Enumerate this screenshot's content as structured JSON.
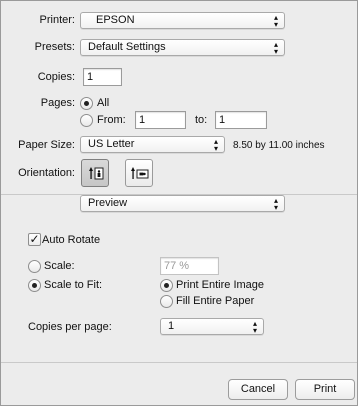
{
  "printer": {
    "label": "Printer:",
    "value": "EPSON"
  },
  "presets": {
    "label": "Presets:",
    "value": "Default Settings"
  },
  "copies": {
    "label": "Copies:",
    "value": "1"
  },
  "pages": {
    "label": "Pages:",
    "all_label": "All",
    "from_label": "From:",
    "from_value": "1",
    "to_label": "to:",
    "to_value": "1"
  },
  "paper_size": {
    "label": "Paper Size:",
    "value": "US Letter",
    "dimensions": "8.50 by 11.00 inches"
  },
  "orientation": {
    "label": "Orientation:"
  },
  "section_menu": {
    "value": "Preview"
  },
  "auto_rotate": {
    "label": "Auto Rotate",
    "checked": true
  },
  "scale": {
    "label": "Scale:",
    "value": "77 %"
  },
  "scale_to_fit": {
    "label": "Scale to Fit:",
    "print_entire_label": "Print Entire Image",
    "fill_entire_label": "Fill Entire Paper"
  },
  "copies_per_page": {
    "label": "Copies per page:",
    "value": "1"
  },
  "footer": {
    "cancel_label": "Cancel",
    "print_label": "Print"
  }
}
